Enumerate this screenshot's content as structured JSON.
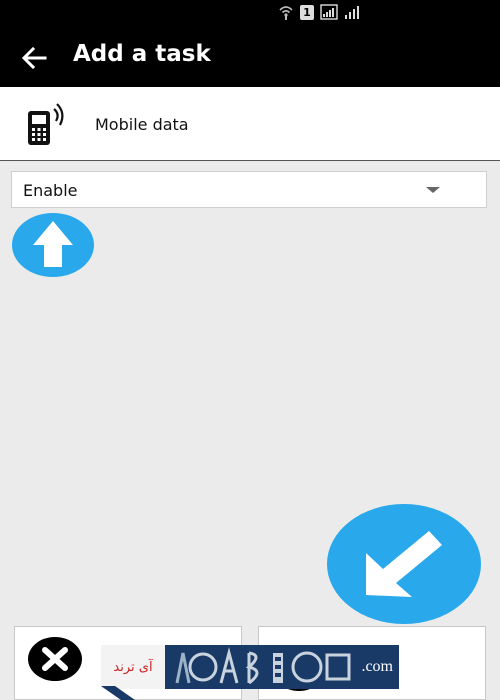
{
  "status_bar": {
    "icons": [
      "wifi-calling-icon",
      "sim-1-icon",
      "signal-icon",
      "signal-icon"
    ],
    "sim_number": "1"
  },
  "toolbar": {
    "title": "Add a task",
    "back_icon": "arrow-back-icon"
  },
  "task": {
    "icon": "mobile-data-icon",
    "label": "Mobile data"
  },
  "action_select": {
    "selected": "Enable",
    "caret_icon": "dropdown-caret-icon"
  },
  "controls": {
    "up_icon": "arrow-up-icon",
    "go_icon": "arrow-down-left-icon",
    "accent_color": "#29a8ec"
  },
  "footer": {
    "cancel_icon": "close-icon",
    "confirm_icon": "confirm-icon"
  },
  "watermark": {
    "persian_text": "آی ترند",
    "domain_suffix": ".com"
  }
}
